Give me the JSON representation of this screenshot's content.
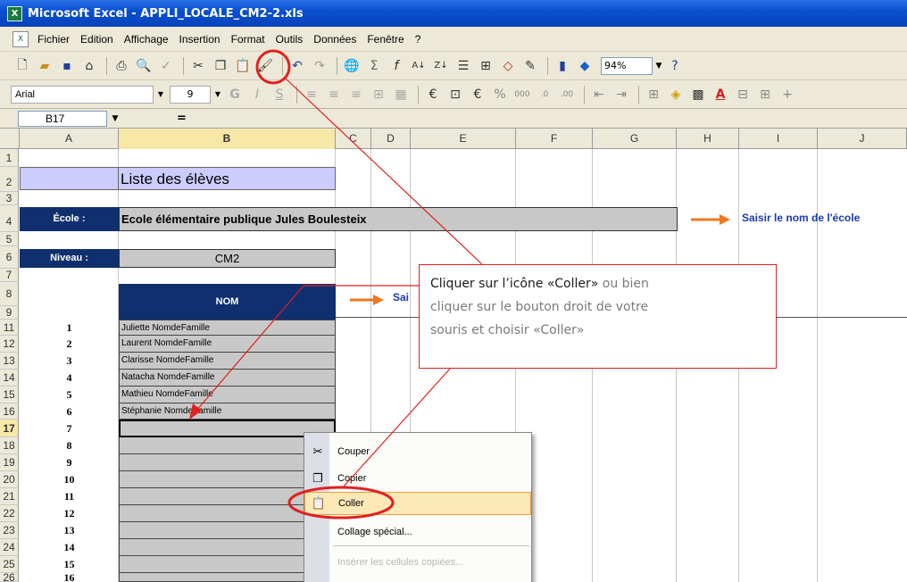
{
  "window": {
    "title": "Microsoft Excel - APPLI_LOCALE_CM2-2.xls"
  },
  "menu": [
    "Fichier",
    "Edition",
    "Affichage",
    "Insertion",
    "Format",
    "Outils",
    "Données",
    "Fenêtre",
    "?"
  ],
  "toolbar": {
    "zoom": "94%",
    "font": "Arial",
    "font_size": "9"
  },
  "formula_bar": {
    "name_box": "B17",
    "equals": "="
  },
  "columns": [
    "A",
    "B",
    "C",
    "D",
    "E",
    "F",
    "G",
    "H",
    "I",
    "J"
  ],
  "rows": [
    "1",
    "2",
    "3",
    "4",
    "5",
    "6",
    "7",
    "8",
    "9",
    "11",
    "12",
    "13",
    "14",
    "15",
    "16",
    "17",
    "18",
    "19",
    "20",
    "21",
    "22",
    "23",
    "24",
    "25",
    "26"
  ],
  "sheet": {
    "title": "Liste des élèves",
    "ecole_label": "École :",
    "ecole_value": "Ecole élémentaire publique Jules Boulesteix",
    "ecole_hint": "Saisir le nom de l'école",
    "niveau_label": "Niveau :",
    "niveau_value": "CM2",
    "nom_header": "NOM",
    "hint_partial": "Sai",
    "students": [
      {
        "num": "1",
        "name": "Juliette NomdeFamille"
      },
      {
        "num": "2",
        "name": "Laurent NomdeFamille"
      },
      {
        "num": "3",
        "name": "Clarisse NomdeFamille"
      },
      {
        "num": "4",
        "name": "Natacha NomdeFamille"
      },
      {
        "num": "5",
        "name": "Mathieu NomdeFamille"
      },
      {
        "num": "6",
        "name": "Stéphanie NomdeFamille"
      },
      {
        "num": "7",
        "name": ""
      },
      {
        "num": "8",
        "name": ""
      },
      {
        "num": "9",
        "name": ""
      },
      {
        "num": "10",
        "name": ""
      },
      {
        "num": "11",
        "name": ""
      },
      {
        "num": "12",
        "name": ""
      },
      {
        "num": "13",
        "name": ""
      },
      {
        "num": "14",
        "name": ""
      },
      {
        "num": "15",
        "name": ""
      },
      {
        "num": "16",
        "name": ""
      }
    ]
  },
  "context_menu": {
    "items": [
      "Couper",
      "Copier",
      "Coller",
      "Collage spécial...",
      "Insérer les cellules copiées..."
    ]
  },
  "callout": {
    "text_dark_1": "Cliquer sur l’icône «Coller»",
    "text_light_1": " ou  bien",
    "text_light_2": "cliquer sur le bouton droit de votre",
    "text_light_3": "souris et choisir «Coller»"
  },
  "colors": {
    "accent_red": "#e02020",
    "orange": "#f07820",
    "header_navy": "#0f2f6e"
  }
}
